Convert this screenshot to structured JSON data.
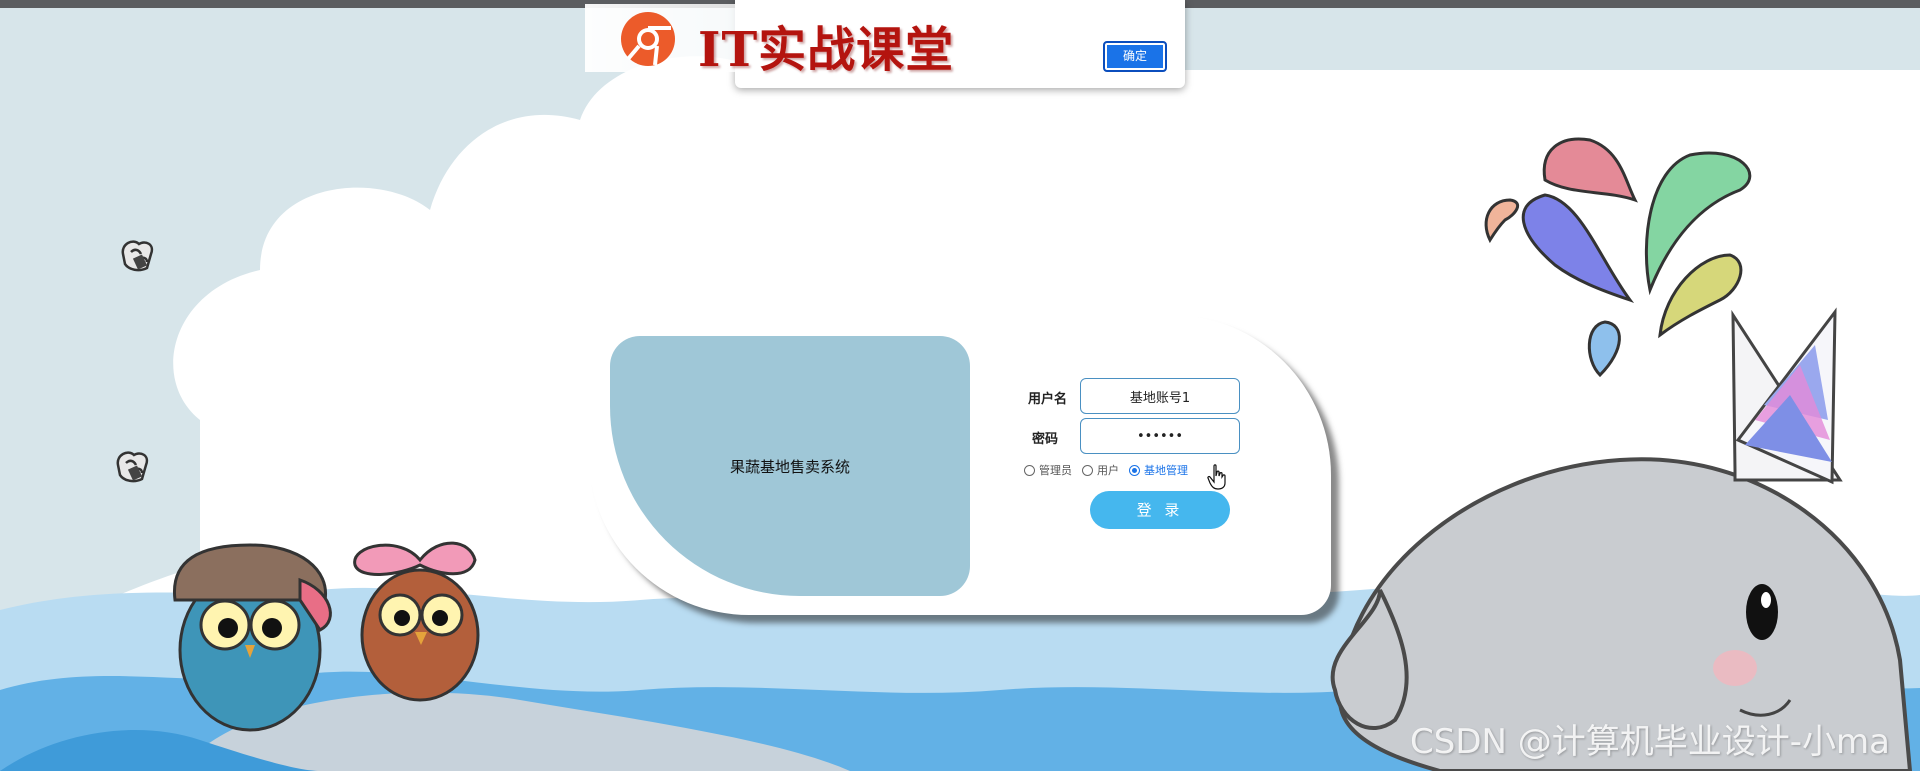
{
  "brand": {
    "text": "IT实战课堂",
    "logo_icon": "brand-logo-icon"
  },
  "alert": {
    "ok_label": "确定"
  },
  "login": {
    "system_title": "果蔬基地售卖系统",
    "username_label": "用户名",
    "username_value": "基地账号1",
    "password_label": "密码",
    "password_value": "••••••",
    "roles": [
      {
        "label": "管理员",
        "checked": false
      },
      {
        "label": "用户",
        "checked": false
      },
      {
        "label": "基地管理",
        "checked": true
      }
    ],
    "submit_label": "登 录"
  },
  "watermark": "CSDN @计算机毕业设计-小ma",
  "colors": {
    "panel": "#9fc7d7",
    "button": "#45b7ee",
    "input_border": "#4a90c2",
    "accent": "#1a73e8",
    "brand_red": "#b4140f"
  }
}
